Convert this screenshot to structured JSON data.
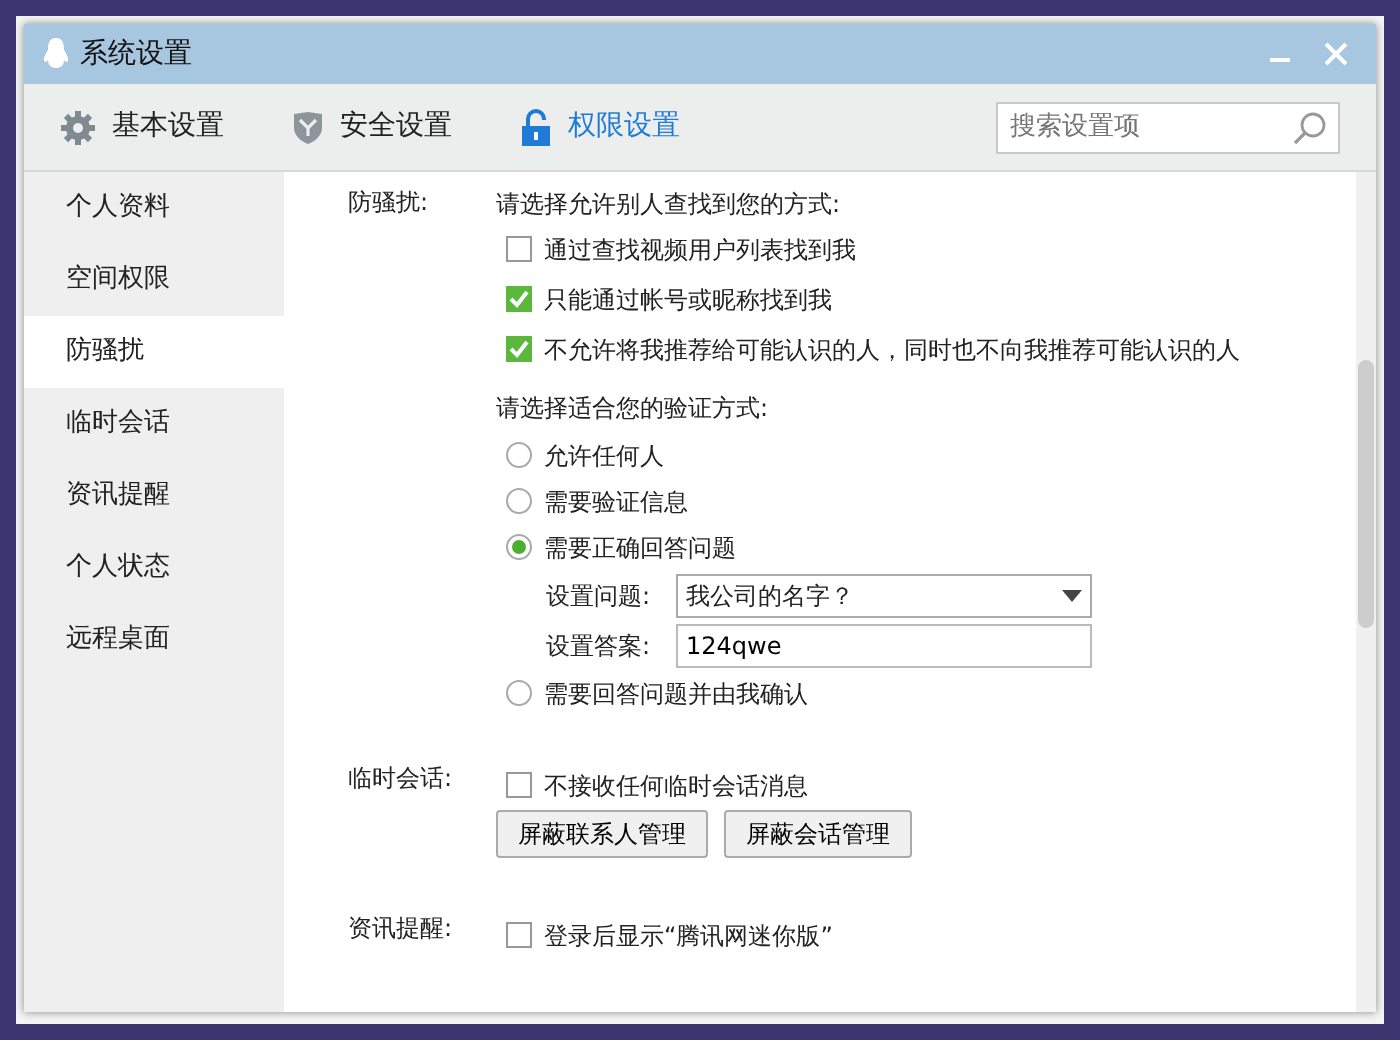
{
  "window": {
    "title": "系统设置"
  },
  "tabs": [
    {
      "label": "基本设置",
      "kind": "gear",
      "selected": false
    },
    {
      "label": "安全设置",
      "kind": "shield",
      "selected": false
    },
    {
      "label": "权限设置",
      "kind": "lock",
      "selected": true
    }
  ],
  "search": {
    "placeholder": "搜索设置项"
  },
  "sidebar": {
    "items": [
      {
        "label": "个人资料",
        "selected": false
      },
      {
        "label": "空间权限",
        "selected": false
      },
      {
        "label": "防骚扰",
        "selected": true
      },
      {
        "label": "临时会话",
        "selected": false
      },
      {
        "label": "资讯提醒",
        "selected": false
      },
      {
        "label": "个人状态",
        "selected": false
      },
      {
        "label": "远程桌面",
        "selected": false
      }
    ]
  },
  "anti_harassment": {
    "label": "防骚扰:",
    "find_prompt": "请选择允许别人查找到您的方式:",
    "find_options": [
      {
        "label": "通过查找视频用户列表找到我",
        "checked": false
      },
      {
        "label": "只能通过帐号或昵称找到我",
        "checked": true
      },
      {
        "label": "不允许将我推荐给可能认识的人，同时也不向我推荐可能认识的人",
        "checked": true
      }
    ],
    "verify_prompt": "请选择适合您的验证方式:",
    "verify_options": [
      {
        "label": "允许任何人",
        "selected": false
      },
      {
        "label": "需要验证信息",
        "selected": false
      },
      {
        "label": "需要正确回答问题",
        "selected": true,
        "fields": [
          {
            "kind": "select",
            "label": "设置问题:",
            "value": "我公司的名字？"
          },
          {
            "kind": "text",
            "label": "设置答案:",
            "value": "124qwe"
          }
        ]
      },
      {
        "label": "需要回答问题并由我确认",
        "selected": false
      }
    ]
  },
  "temp_session": {
    "label": "临时会话:",
    "option": {
      "label": "不接收任何临时会话消息",
      "checked": false
    },
    "buttons": [
      "屏蔽联系人管理",
      "屏蔽会话管理"
    ]
  },
  "news": {
    "label": "资讯提醒:",
    "option": {
      "label": "登录后显示“腾讯网迷你版”",
      "checked": false
    }
  }
}
